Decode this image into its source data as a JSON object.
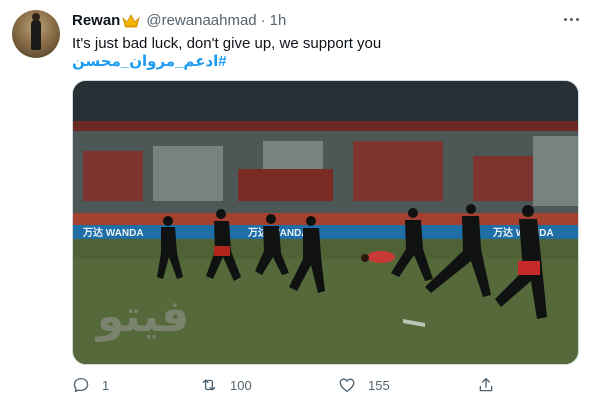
{
  "tweet": {
    "display_name": "Rewan",
    "handle": "@rewanaahmad",
    "separator": "·",
    "time": "1h",
    "text": "It's just bad luck, don't give up, we support you",
    "hashtag": "#ادعم_مروان_محسن",
    "avatar_icon": "profile-avatar",
    "name_emoji": "crown-icon"
  },
  "media": {
    "banner_text": "万达 WANDA",
    "watermark": "فيتو"
  },
  "actions": {
    "reply_count": "1",
    "retweet_count": "100",
    "like_count": "155",
    "share_label": ""
  },
  "colors": {
    "accent": "#1d9bf0",
    "secondary_text": "#536471",
    "crown": "#f4b400"
  }
}
